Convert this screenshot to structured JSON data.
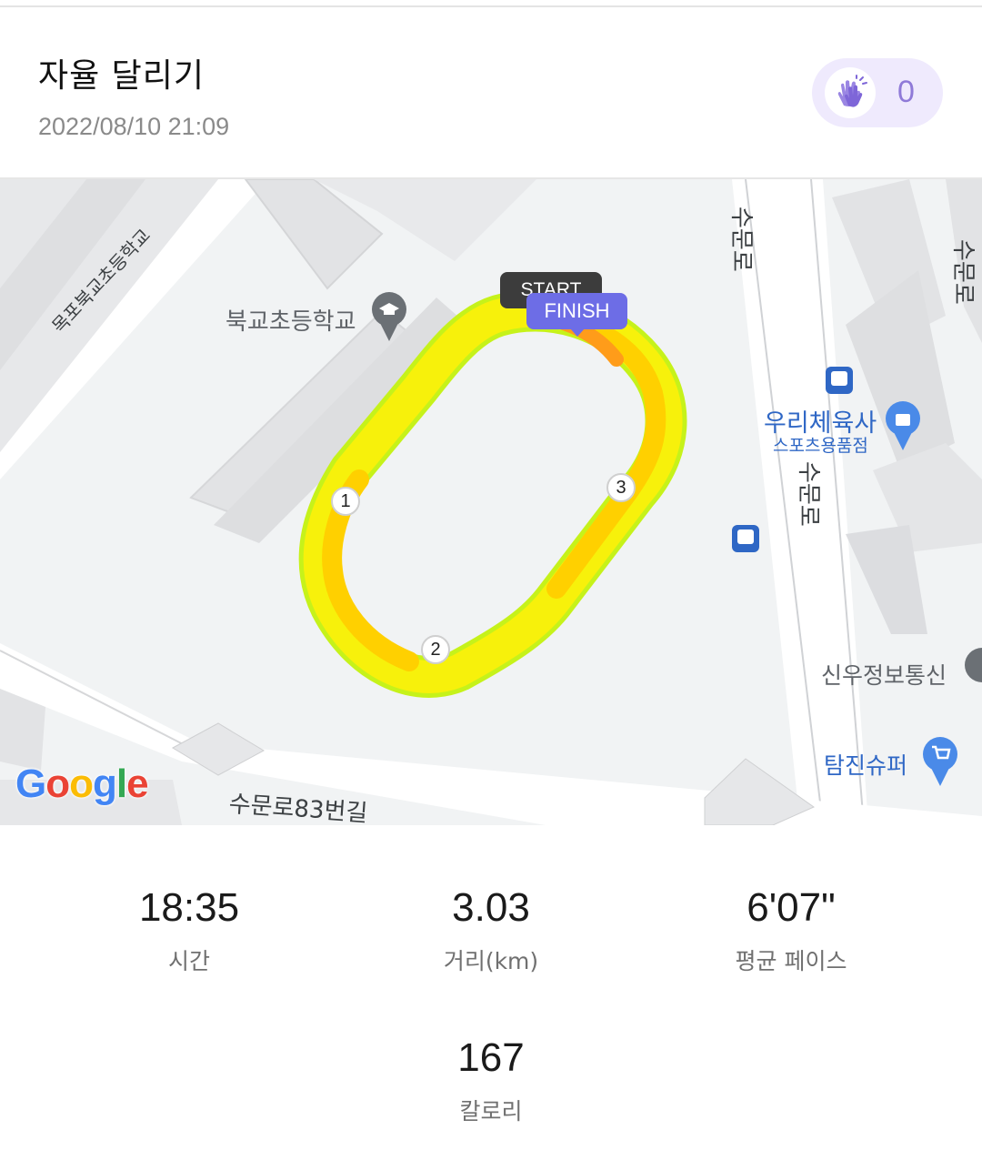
{
  "header": {
    "title": "자율 달리기",
    "date": "2022/08/10 21:09",
    "clap_count": "0",
    "clap_icon": "clapping-hands-icon"
  },
  "map": {
    "poi": {
      "school": "북교초등학교",
      "sports_store_name": "우리체육사",
      "sports_store_sub": "스포츠용품점",
      "telecom": "신우정보통신",
      "supermarket": "탐진슈퍼"
    },
    "roads": {
      "diag": "목포북교초등학교",
      "suburo_83": "수문로83번길",
      "suburo_top": "수문로",
      "suburo_mid": "수문로",
      "suburo_right": "수문로"
    },
    "start_label": "START",
    "finish_label": "FINISH",
    "km_markers": [
      "1",
      "2",
      "3"
    ],
    "google_logo": [
      "G",
      "o",
      "o",
      "g",
      "l",
      "e"
    ],
    "route_colors": [
      "#f7f10b",
      "#ffd000",
      "#c6f21a",
      "#ff9c1a"
    ]
  },
  "stats": {
    "time": {
      "value": "18:35",
      "label": "시간"
    },
    "distance": {
      "value": "3.03",
      "label": "거리(km)"
    },
    "pace": {
      "value": "6'07\"",
      "label": "평균 페이스"
    },
    "calories": {
      "value": "167",
      "label": "칼로리"
    }
  }
}
